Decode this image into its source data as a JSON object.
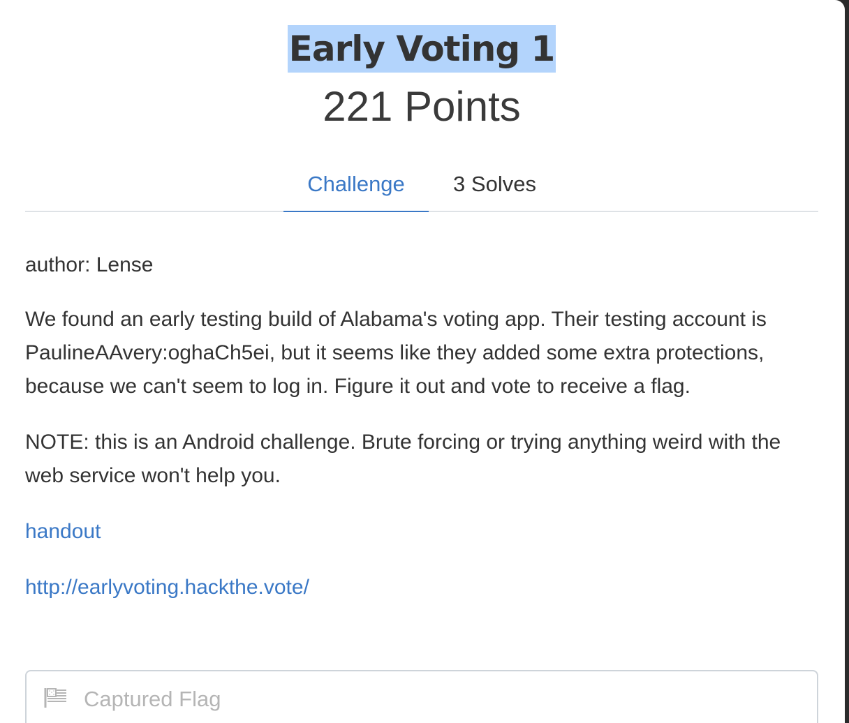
{
  "challenge": {
    "title": "Early Voting 1",
    "points": "221 Points"
  },
  "tabs": [
    {
      "label": "Challenge",
      "active": true
    },
    {
      "label": "3 Solves",
      "active": false
    }
  ],
  "description": {
    "author": "author: Lense",
    "paragraph1": "We found an early testing build of Alabama's voting app. Their testing account is PaulineAAvery:oghaCh5ei, but it seems like they added some extra protections, because we can't seem to log in. Figure it out and vote to receive a flag.",
    "note": "NOTE: this is an Android challenge. Brute forcing or trying anything weird with the web service won't help you.",
    "links": [
      {
        "label": "handout"
      },
      {
        "label": "http://earlyvoting.hackthe.vote/"
      }
    ]
  },
  "flag_input": {
    "placeholder": "Captured Flag",
    "value": "",
    "icon": "flag-icon"
  },
  "colors": {
    "accent": "#3a78c6",
    "selection_highlight": "#b3d4fc",
    "text": "#333333",
    "border": "#dee2e6"
  }
}
